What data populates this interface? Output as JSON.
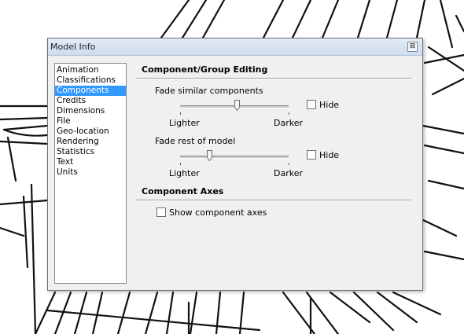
{
  "window": {
    "title": "Model Info",
    "close_glyph": "⊠"
  },
  "sidebar": {
    "items": [
      "Animation",
      "Classifications",
      "Components",
      "Credits",
      "Dimensions",
      "File",
      "Geo-location",
      "Rendering",
      "Statistics",
      "Text",
      "Units"
    ],
    "selected": "Components"
  },
  "editing": {
    "heading": "Component/Group Editing",
    "similar": {
      "label": "Fade similar components",
      "value": 0.52,
      "min_label": "Lighter",
      "max_label": "Darker",
      "hide_label": "Hide",
      "hide_checked": false
    },
    "rest": {
      "label": "Fade rest of model",
      "value": 0.27,
      "min_label": "Lighter",
      "max_label": "Darker",
      "hide_label": "Hide",
      "hide_checked": false
    }
  },
  "axes": {
    "heading": "Component Axes",
    "show_label": "Show component axes",
    "show_checked": false
  }
}
